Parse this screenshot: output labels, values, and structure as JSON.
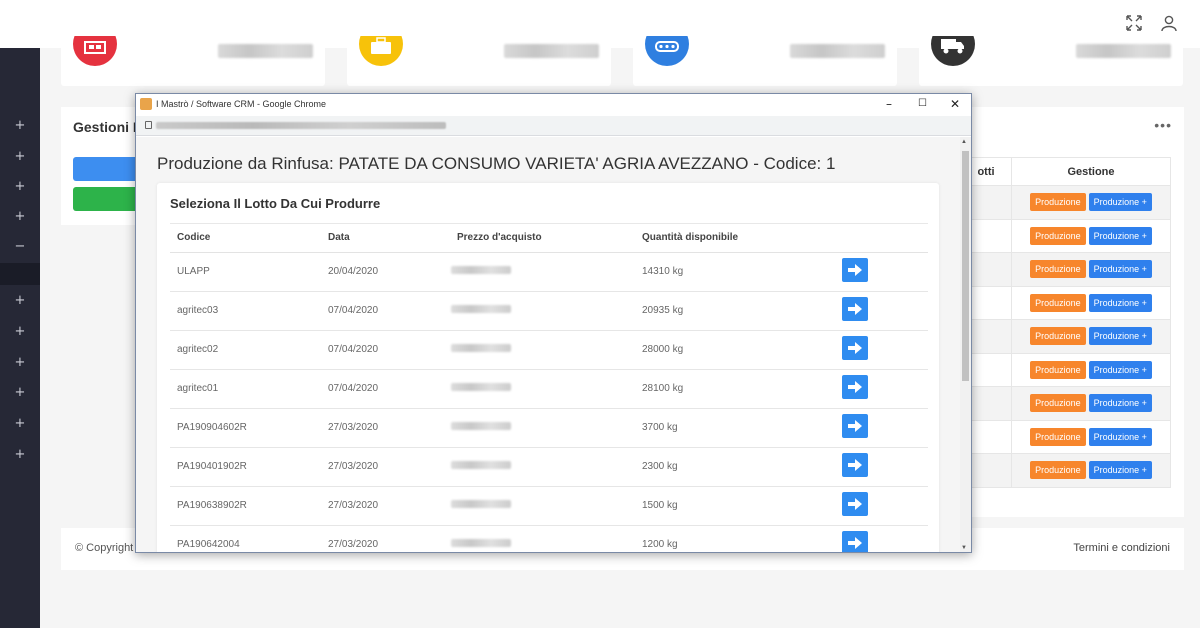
{
  "footer": {
    "copyright": "© Copyright",
    "terms": "Termini e condizioni"
  },
  "background_panel": {
    "title": "Gestioni R"
  },
  "right_panel": {
    "header_partial": "otti",
    "header_gestione": "Gestione",
    "rows": [
      {
        "partial": "",
        "b1": "Produzione",
        "b2": "Produzione +"
      },
      {
        "partial": "",
        "b1": "Produzione",
        "b2": "Produzione +"
      },
      {
        "partial": "",
        "b1": "Produzione",
        "b2": "Produzione +"
      },
      {
        "partial": "",
        "b1": "Produzione",
        "b2": "Produzione +"
      },
      {
        "partial": "",
        "b1": "Produzione",
        "b2": "Produzione +"
      },
      {
        "partial": "",
        "b1": "Produzione",
        "b2": "Produzione +"
      },
      {
        "partial": "",
        "b1": "Produzione",
        "b2": "Produzione +"
      },
      {
        "partial": "",
        "b1": "Produzione",
        "b2": "Produzione +"
      },
      {
        "partial": "",
        "b1": "Produzione",
        "b2": "Produzione +"
      }
    ]
  },
  "sidebar": {
    "items": [
      "+",
      "+",
      "+",
      "+",
      "−",
      "+",
      "+",
      "+",
      "+",
      "+",
      "+"
    ]
  },
  "popup": {
    "window_title": "I Mastrò / Software CRM - Google Chrome",
    "page_title": "Produzione da Rinfusa: PATATE DA CONSUMO VARIETA' AGRIA AVEZZANO - Codice: 1",
    "section_title": "Seleziona Il Lotto Da Cui Produrre",
    "columns": [
      "Codice",
      "Data",
      "Prezzo d'acquisto",
      "Quantità disponibile"
    ],
    "rows": [
      {
        "codice": "ULAPP",
        "data": "20/04/2020",
        "quantita": "14310 kg"
      },
      {
        "codice": "agritec03",
        "data": "07/04/2020",
        "quantita": "20935 kg"
      },
      {
        "codice": "agritec02",
        "data": "07/04/2020",
        "quantita": "28000 kg"
      },
      {
        "codice": "agritec01",
        "data": "07/04/2020",
        "quantita": "28100 kg"
      },
      {
        "codice": "PA190904602R",
        "data": "27/03/2020",
        "quantita": "3700 kg"
      },
      {
        "codice": "PA190401902R",
        "data": "27/03/2020",
        "quantita": "2300 kg"
      },
      {
        "codice": "PA190638902R",
        "data": "27/03/2020",
        "quantita": "1500 kg"
      },
      {
        "codice": "PA190642004",
        "data": "27/03/2020",
        "quantita": "1200 kg"
      }
    ]
  },
  "cards": [
    {
      "icon": "store-icon",
      "color": "#e5323f"
    },
    {
      "icon": "briefcase-icon",
      "color": "#f7c20a"
    },
    {
      "icon": "conveyor-icon",
      "color": "#2f7fe0"
    },
    {
      "icon": "truck-icon",
      "color": "#333333"
    }
  ]
}
